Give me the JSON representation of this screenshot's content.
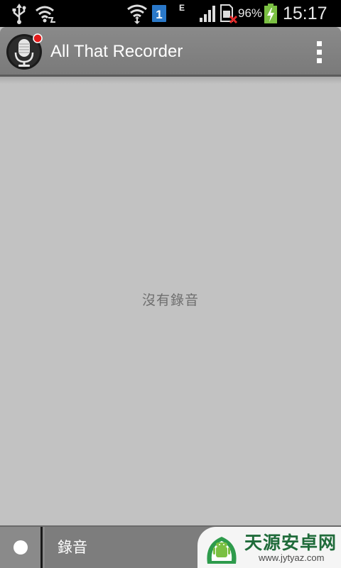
{
  "status_bar": {
    "network_label": "E",
    "sim_label": "1",
    "battery_percent": "96%",
    "time": "15:17",
    "icons": [
      "usb-icon",
      "wifi-hotspot-icon",
      "wifi-icon",
      "sim-icon",
      "signal-icon",
      "sim-missing-icon",
      "battery-charging-icon"
    ]
  },
  "action_bar": {
    "title": "All That Recorder",
    "app_icon": "microphone-icon",
    "overflow_icon": "overflow-menu-icon"
  },
  "main": {
    "empty_message": "沒有錄音"
  },
  "bottom_bar": {
    "record_label": "錄音",
    "record_icon": "record-dot-icon"
  },
  "watermark": {
    "text": "天源安卓网",
    "url": "www.jytyaz.com"
  },
  "colors": {
    "background": "#c2c2c2",
    "action_bar": "#828282",
    "bottom_bar": "#7d7d7d",
    "status_bar": "#000000",
    "battery": "#7bc043",
    "watermark_green": "#1f6b3a"
  }
}
